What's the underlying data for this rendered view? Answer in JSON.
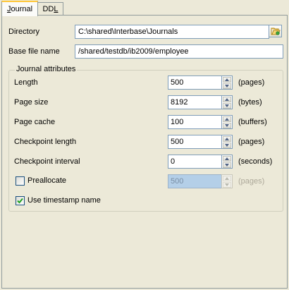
{
  "tabs": [
    {
      "label_prefix": "",
      "label_underlined": "J",
      "label_rest": "ournal",
      "active": true
    },
    {
      "label_prefix": "DD",
      "label_underlined": "L",
      "label_rest": "",
      "active": false
    }
  ],
  "directory": {
    "label": "Directory",
    "value": "C:\\shared\\Interbase\\Journals",
    "button_icon": "folder-open-icon"
  },
  "base_file_name": {
    "label": "Base file name",
    "value": "/shared/testdb/ib2009/employee"
  },
  "journal_attributes": {
    "title": "Journal attributes",
    "length": {
      "label": "Length",
      "value": "500",
      "unit": "(pages)"
    },
    "page_size": {
      "label": "Page size",
      "value": "8192",
      "unit": "(bytes)"
    },
    "page_cache": {
      "label": "Page cache",
      "value": "100",
      "unit": "(buffers)"
    },
    "checkpoint_length": {
      "label": "Checkpoint length",
      "value": "500",
      "unit": "(pages)"
    },
    "checkpoint_interval": {
      "label": "Checkpoint interval",
      "value": "0",
      "unit": "(seconds)"
    },
    "preallocate": {
      "label": "Preallocate",
      "checked": false,
      "value": "500",
      "unit": "(pages)",
      "enabled": false
    },
    "use_timestamp_name": {
      "label": "Use timestamp name",
      "checked": true
    }
  },
  "colors": {
    "tab_highlight": "#ffc83c",
    "disabled_field": "#b4cfe8",
    "checkbox_check": "#21a121"
  }
}
